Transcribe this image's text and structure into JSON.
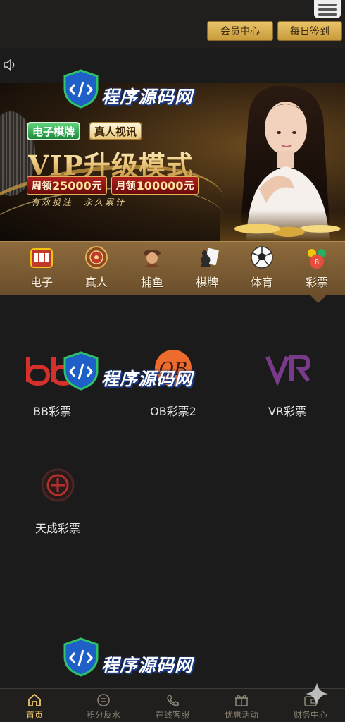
{
  "header": {
    "menu_icon": "hamburger-menu-icon",
    "member_center_label": "会员中心",
    "daily_checkin_label": "每日签到"
  },
  "notice": {
    "icon": "speaker-icon"
  },
  "banner": {
    "tag_1": "电子棋牌",
    "tag_2": "真人视讯",
    "title": "VIP升级模式",
    "weekly_prefix": "周领",
    "weekly_amount": "25000",
    "weekly_unit": "元",
    "monthly_prefix": "月领",
    "monthly_amount": "100000",
    "monthly_unit": "元",
    "slogan": "有效投注　永久累计"
  },
  "categories": [
    {
      "label": "电子",
      "icon": "slot-machine-icon"
    },
    {
      "label": "真人",
      "icon": "roulette-icon"
    },
    {
      "label": "捕鱼",
      "icon": "fishing-icon"
    },
    {
      "label": "棋牌",
      "icon": "chess-cards-icon"
    },
    {
      "label": "体育",
      "icon": "soccer-ball-icon"
    },
    {
      "label": "彩票",
      "icon": "lottery-balls-icon",
      "active": true
    }
  ],
  "games": [
    {
      "name": "BB彩票",
      "icon": "bb-logo-icon"
    },
    {
      "name": "OB彩票2",
      "icon": "ob-logo-icon"
    },
    {
      "name": "VR彩票",
      "icon": "vr-logo-icon"
    },
    {
      "name": "天成彩票",
      "icon": "tiancheng-logo-icon"
    }
  ],
  "watermark": "程序源码网",
  "bottom_nav": [
    {
      "label": "首页",
      "icon": "home-icon",
      "active": true
    },
    {
      "label": "积分反水",
      "icon": "rebate-icon"
    },
    {
      "label": "在线客服",
      "icon": "phone-icon"
    },
    {
      "label": "优惠活动",
      "icon": "gift-icon"
    },
    {
      "label": "财务中心",
      "icon": "wallet-icon"
    }
  ],
  "colors": {
    "background": "#1c1b1b",
    "gold_button": "#d9b050",
    "category_bar": "#7a5a33",
    "active_nav": "#e8c46a"
  }
}
